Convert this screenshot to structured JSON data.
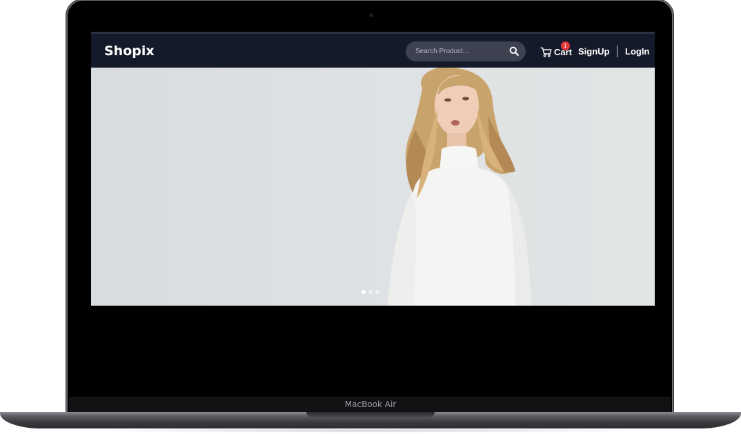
{
  "device": {
    "label": "MacBook Air"
  },
  "navbar": {
    "brand": "Shopix",
    "search": {
      "placeholder": "Search Product...",
      "icon": "search-icon"
    },
    "cart": {
      "label": "Cart",
      "badge": "1",
      "icon": "cart-icon"
    },
    "signup_label": "SignUp",
    "login_label": "LogIn"
  },
  "hero": {
    "slides_count": 3,
    "active_slide": 1
  },
  "colors": {
    "navbar_bg": "#141a29",
    "badge": "#e5383b",
    "hero_bg": "#dfe2e4"
  }
}
